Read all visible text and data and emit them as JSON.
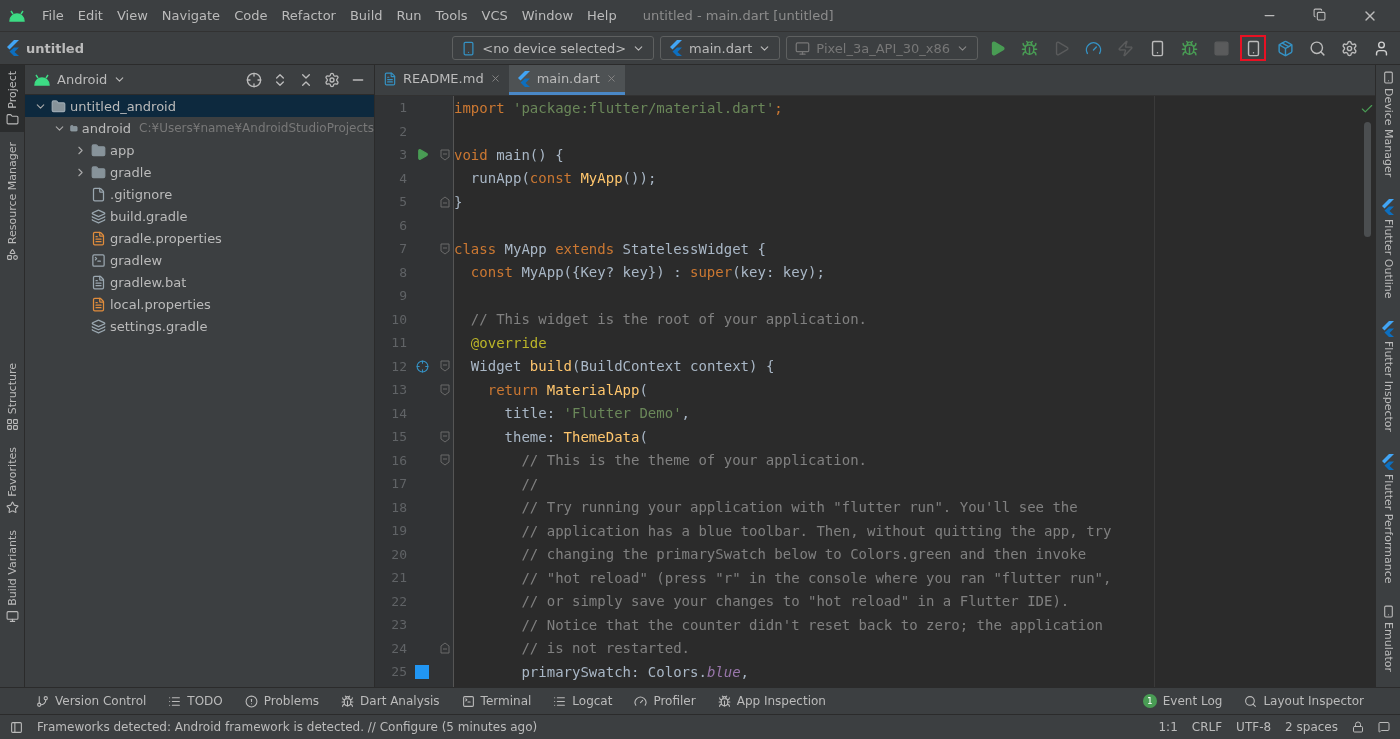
{
  "menu_bar": {
    "items": [
      "File",
      "Edit",
      "View",
      "Navigate",
      "Code",
      "Refactor",
      "Build",
      "Run",
      "Tools",
      "VCS",
      "Window",
      "Help"
    ],
    "title": "untitled - main.dart [untitled]"
  },
  "toolbar": {
    "project": "untitled",
    "device_selector": "<no device selected>",
    "run_config": "main.dart",
    "emulator_selector": "Pixel_3a_API_30_x86",
    "actions": [
      {
        "kind": "run",
        "disabled": false,
        "highlighted": false
      },
      {
        "kind": "debug",
        "disabled": false,
        "highlighted": false
      },
      {
        "kind": "attach",
        "disabled": true,
        "highlighted": false
      },
      {
        "kind": "profile",
        "disabled": false,
        "highlighted": false
      },
      {
        "kind": "hot_reload",
        "disabled": true,
        "highlighted": false
      },
      {
        "kind": "device_flutter",
        "disabled": false,
        "highlighted": false
      },
      {
        "kind": "attach_debugger",
        "disabled": false,
        "highlighted": false
      },
      {
        "kind": "stop",
        "disabled": true,
        "highlighted": false
      },
      {
        "kind": "avd_manager",
        "disabled": false,
        "highlighted": true
      },
      {
        "kind": "sdk_manager",
        "disabled": false,
        "highlighted": false
      },
      {
        "kind": "search",
        "disabled": false,
        "highlighted": false
      },
      {
        "kind": "settings",
        "disabled": false,
        "highlighted": false
      },
      {
        "kind": "account",
        "disabled": false,
        "highlighted": false
      }
    ]
  },
  "left_strip": [
    {
      "label": "Project",
      "selected": true,
      "kind": "project"
    },
    {
      "label": "Resource Manager",
      "selected": false,
      "kind": "resources"
    },
    {
      "label": "Structure",
      "selected": false,
      "kind": "structure"
    },
    {
      "label": "Favorites",
      "selected": false,
      "kind": "favorites"
    },
    {
      "label": "Build Variants",
      "selected": false,
      "kind": "variants"
    }
  ],
  "project_panel": {
    "view": "Android",
    "tree": [
      {
        "label": "untitled_android",
        "kind": "module",
        "selected": true,
        "expanded": true,
        "children": [
          {
            "label": "android",
            "kind": "module",
            "selected": false,
            "expanded": true,
            "hint": "C:¥Users¥name¥AndroidStudioProjects",
            "children": [
              {
                "label": "app",
                "kind": "folder",
                "selected": false,
                "expanded": false
              },
              {
                "label": "gradle",
                "kind": "folder",
                "selected": false,
                "expanded": false
              },
              {
                "label": ".gitignore",
                "kind": "ignore",
                "selected": false
              },
              {
                "label": "build.gradle",
                "kind": "gradle",
                "selected": false
              },
              {
                "label": "gradle.properties",
                "kind": "properties",
                "selected": false
              },
              {
                "label": "gradlew",
                "kind": "script",
                "selected": false
              },
              {
                "label": "gradlew.bat",
                "kind": "text",
                "selected": false
              },
              {
                "label": "local.properties",
                "kind": "properties",
                "selected": false
              },
              {
                "label": "settings.gradle",
                "kind": "gradle",
                "selected": false
              }
            ]
          }
        ]
      }
    ]
  },
  "editor": {
    "tabs": [
      {
        "label": "README.md",
        "kind": "markdown",
        "selected": false
      },
      {
        "label": "main.dart",
        "kind": "dart",
        "selected": true
      }
    ],
    "lines": [
      {
        "number": "1",
        "tokens": [
          {
            "kind": "kw",
            "text": "import "
          },
          {
            "kind": "str",
            "text": "'package:flutter/material.dart'"
          },
          {
            "kind": "kw",
            "text": ";"
          }
        ]
      },
      {
        "number": "2"
      },
      {
        "number": "3",
        "gutter_mark": {
          "kind": "run"
        },
        "fold_mark": {
          "kind": "start"
        },
        "tokens": [
          {
            "kind": "kw",
            "text": "void "
          },
          {
            "kind": "plain",
            "text": "main() {"
          }
        ]
      },
      {
        "number": "4",
        "tokens": [
          {
            "kind": "plain",
            "text": "  runApp("
          },
          {
            "kind": "kw",
            "text": "const "
          },
          {
            "kind": "fn",
            "text": "MyApp"
          },
          {
            "kind": "plain",
            "text": "());"
          }
        ]
      },
      {
        "number": "5",
        "fold_mark": {
          "kind": "end"
        },
        "tokens": [
          {
            "kind": "plain",
            "text": "}"
          }
        ]
      },
      {
        "number": "6"
      },
      {
        "number": "7",
        "fold_mark": {
          "kind": "start"
        },
        "tokens": [
          {
            "kind": "kw",
            "text": "class "
          },
          {
            "kind": "plain",
            "text": "MyApp "
          },
          {
            "kind": "kw",
            "text": "extends "
          },
          {
            "kind": "plain",
            "text": "StatelessWidget {"
          }
        ]
      },
      {
        "number": "8",
        "tokens": [
          {
            "kind": "kw",
            "text": "  const "
          },
          {
            "kind": "plain",
            "text": "MyApp({Key? key}) : "
          },
          {
            "kind": "kw",
            "text": "super"
          },
          {
            "kind": "plain",
            "text": "(key: key);"
          }
        ]
      },
      {
        "number": "9"
      },
      {
        "number": "10",
        "tokens": [
          {
            "kind": "com",
            "text": "  // This widget is the root of your application."
          }
        ]
      },
      {
        "number": "11",
        "tokens": [
          {
            "kind": "ann",
            "text": "  @override"
          }
        ]
      },
      {
        "number": "12",
        "gutter_mark": {
          "kind": "override"
        },
        "fold_mark": {
          "kind": "start"
        },
        "tokens": [
          {
            "kind": "plain",
            "text": "  Widget "
          },
          {
            "kind": "fn",
            "text": "build"
          },
          {
            "kind": "plain",
            "text": "(BuildContext context) {"
          }
        ]
      },
      {
        "number": "13",
        "fold_mark": {
          "kind": "start"
        },
        "tokens": [
          {
            "kind": "kw",
            "text": "    return "
          },
          {
            "kind": "fn",
            "text": "MaterialApp"
          },
          {
            "kind": "plain",
            "text": "("
          }
        ]
      },
      {
        "number": "14",
        "tokens": [
          {
            "kind": "plain",
            "text": "      title: "
          },
          {
            "kind": "str",
            "text": "'Flutter Demo'"
          },
          {
            "kind": "plain",
            "text": ","
          }
        ]
      },
      {
        "number": "15",
        "fold_mark": {
          "kind": "start"
        },
        "tokens": [
          {
            "kind": "plain",
            "text": "      theme: "
          },
          {
            "kind": "fn",
            "text": "ThemeData"
          },
          {
            "kind": "plain",
            "text": "("
          }
        ]
      },
      {
        "number": "16",
        "fold_mark": {
          "kind": "start"
        },
        "tokens": [
          {
            "kind": "com",
            "text": "        // This is the theme of your application."
          }
        ]
      },
      {
        "number": "17",
        "tokens": [
          {
            "kind": "com",
            "text": "        //"
          }
        ]
      },
      {
        "number": "18",
        "tokens": [
          {
            "kind": "com",
            "text": "        // Try running your application with \"flutter run\". You'll see the"
          }
        ]
      },
      {
        "number": "19",
        "tokens": [
          {
            "kind": "com",
            "text": "        // application has a blue toolbar. Then, without quitting the app, try"
          }
        ]
      },
      {
        "number": "20",
        "tokens": [
          {
            "kind": "com",
            "text": "        // changing the primarySwatch below to Colors.green and then invoke"
          }
        ]
      },
      {
        "number": "21",
        "tokens": [
          {
            "kind": "com",
            "text": "        // \"hot reload\" (press \"r\" in the console where you ran \"flutter run\","
          }
        ]
      },
      {
        "number": "22",
        "tokens": [
          {
            "kind": "com",
            "text": "        // or simply save your changes to \"hot reload\" in a Flutter IDE)."
          }
        ]
      },
      {
        "number": "23",
        "tokens": [
          {
            "kind": "com",
            "text": "        // Notice that the counter didn't reset back to zero; the application"
          }
        ]
      },
      {
        "number": "24",
        "fold_mark": {
          "kind": "end"
        },
        "tokens": [
          {
            "kind": "com",
            "text": "        // is not restarted."
          }
        ]
      },
      {
        "number": "25",
        "gutter_mark": {
          "kind": "color",
          "color": "#2196f3"
        },
        "tokens": [
          {
            "kind": "plain",
            "text": "        primarySwatch: Colors."
          },
          {
            "kind": "it",
            "text": "blue"
          },
          {
            "kind": "plain",
            "text": ","
          }
        ]
      }
    ]
  },
  "right_strip": [
    {
      "label": "Device Manager",
      "kind": "device"
    },
    {
      "label": "Flutter Outline",
      "kind": "flutter"
    },
    {
      "label": "Flutter Inspector",
      "kind": "flutter"
    },
    {
      "label": "Flutter Performance",
      "kind": "flutter"
    },
    {
      "label": "Emulator",
      "kind": "device"
    }
  ],
  "tool_windows": [
    {
      "label": "Version Control",
      "kind": "vcs"
    },
    {
      "label": "TODO",
      "kind": "todo"
    },
    {
      "label": "Problems",
      "kind": "problems"
    },
    {
      "label": "Dart Analysis",
      "kind": "analysis"
    },
    {
      "label": "Terminal",
      "kind": "terminal"
    },
    {
      "label": "Logcat",
      "kind": "logcat"
    },
    {
      "label": "Profiler",
      "kind": "profiler"
    },
    {
      "label": "App Inspection",
      "kind": "inspection"
    }
  ],
  "tool_windows_right": [
    {
      "label": "Event Log",
      "kind": "events",
      "badge": "1"
    },
    {
      "label": "Layout Inspector",
      "kind": "layout"
    }
  ],
  "status_bar": {
    "message": "Frameworks detected: Android framework is detected. // Configure (5 minutes ago)",
    "items": [
      "1:1",
      "CRLF",
      "UTF-8",
      "2 spaces"
    ]
  }
}
